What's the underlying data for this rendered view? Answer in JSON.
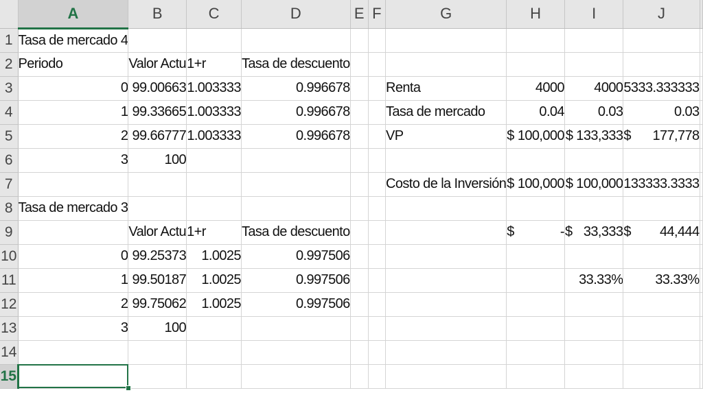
{
  "columns": [
    "A",
    "B",
    "C",
    "D",
    "E",
    "F",
    "G",
    "H",
    "I",
    "J"
  ],
  "rows": [
    "1",
    "2",
    "3",
    "4",
    "5",
    "6",
    "7",
    "8",
    "9",
    "10",
    "11",
    "12",
    "13",
    "14",
    "15"
  ],
  "cells": {
    "A1": "Tasa de mercado 4",
    "A2": "Periodo",
    "B2": "Valor Actu",
    "C2": "1+r",
    "D2": "Tasa de descuento",
    "A3": "0",
    "B3": "99.00663",
    "C3": "1.003333",
    "D3": "0.996678",
    "A4": "1",
    "B4": "99.33665",
    "C4": "1.003333",
    "D4": "0.996678",
    "A5": "2",
    "B5": "99.66777",
    "C5": "1.003333",
    "D5": "0.996678",
    "A6": "3",
    "B6": "100",
    "A8": "Tasa de mercado 3",
    "B9": "Valor Actu",
    "C9": "1+r",
    "D9": "Tasa de descuento",
    "A10": "0",
    "B10": "99.25373",
    "C10": "1.0025",
    "D10": "0.997506",
    "A11": "1",
    "B11": "99.50187",
    "C11": "1.0025",
    "D11": "0.997506",
    "A12": "2",
    "B12": "99.75062",
    "C12": "1.0025",
    "D12": "0.997506",
    "A13": "3",
    "B13": "100",
    "G3": "Renta",
    "H3": "4000",
    "I3": "4000",
    "J3": "5333.333333",
    "G4": "Tasa de mercado",
    "H4": "0.04",
    "I4": "0.03",
    "J4": "0.03",
    "G5": "VP",
    "H5_sym": "$",
    "H5": "100,000",
    "I5": "$ 133,333",
    "J5_sym": "$",
    "J5": "177,778",
    "G7": "Costo de la Inversión",
    "H7_sym": "$",
    "H7": "100,000",
    "I7": "$ 100,000",
    "J7": "133333.3333",
    "H9_sym": "$",
    "H9": "-",
    "I9_sym": "$",
    "I9": "33,333",
    "J9_sym": "$",
    "J9": "44,444",
    "I11": "33.33%",
    "J11": "33.33%"
  },
  "active_cell": "A15",
  "colors": {
    "accent": "#217346",
    "header_bg": "#e6e6e6",
    "gridline": "#d4d4d4"
  }
}
